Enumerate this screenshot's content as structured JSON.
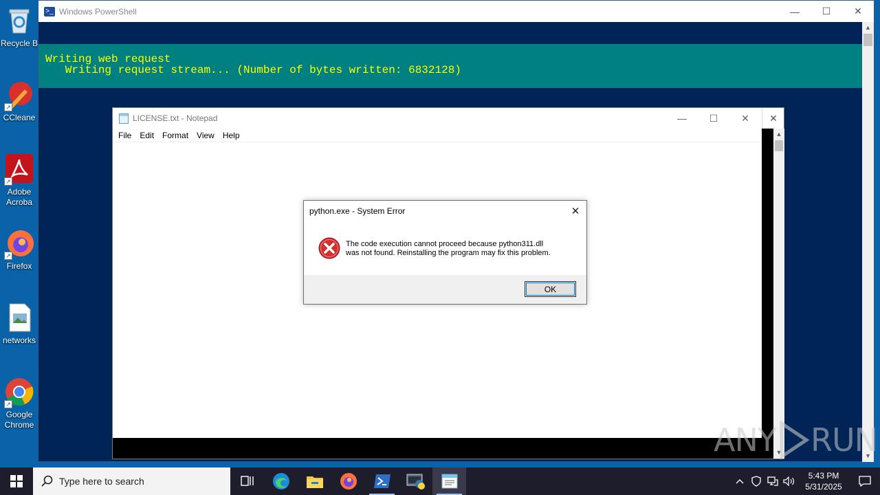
{
  "desktop": {
    "icons": [
      {
        "label": "Recycle B",
        "icon": "recycle-bin-icon"
      },
      {
        "label": "CCleane",
        "icon": "ccleaner-icon"
      },
      {
        "label": "Adobe Acroba",
        "icon": "adobe-acrobat-icon"
      },
      {
        "label": "Firefox",
        "icon": "firefox-icon"
      },
      {
        "label": "networks",
        "icon": "image-file-icon"
      },
      {
        "label": "Google Chrome",
        "icon": "chrome-icon"
      }
    ]
  },
  "powershell": {
    "title": "Windows PowerShell",
    "progress_line1": "Writing web request",
    "progress_line2": "   Writing request stream... (Number of bytes written: 6832128)"
  },
  "notepad": {
    "title": "LICENSE.txt - Notepad",
    "menu": [
      "File",
      "Edit",
      "Format",
      "View",
      "Help"
    ]
  },
  "dialog": {
    "title": "python.exe - System Error",
    "message_line1": "The code execution cannot proceed because python311.dll",
    "message_line2": "was not found. Reinstalling the program may fix this problem.",
    "ok_label": "OK"
  },
  "watermark": {
    "left": "ANY",
    "right": "RUN"
  },
  "taskbar": {
    "search_placeholder": "Type here to search",
    "apps": [
      "task-view",
      "edge",
      "file-explorer",
      "firefox",
      "powershell",
      "python-setup",
      "notepad"
    ],
    "active_app": "notepad",
    "time": "5:43 PM",
    "date": "5/31/2025"
  },
  "colors": {
    "desktop_bg": "#0a62a8",
    "powershell_bg": "#012456",
    "progress_bg": "#008080",
    "progress_text": "#ffff00",
    "taskbar_bg": "#1d1d2b",
    "error_red": "#d32f2f"
  }
}
